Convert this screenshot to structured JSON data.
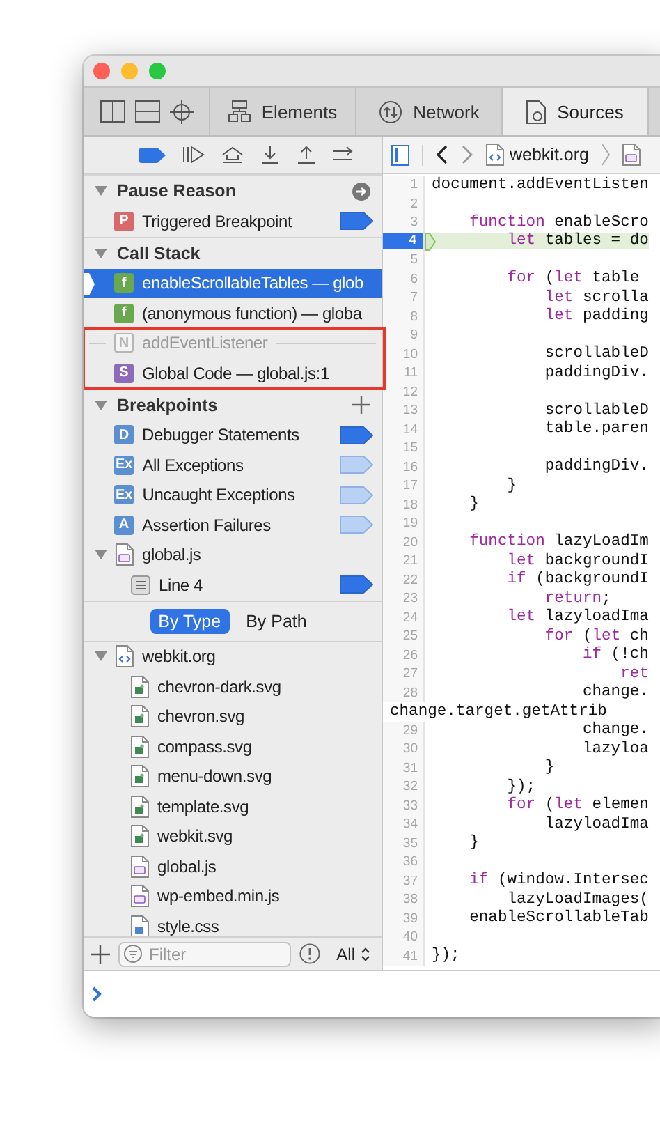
{
  "tabs": [
    {
      "label": "Elements",
      "kind": "elements",
      "selected": false
    },
    {
      "label": "Network",
      "kind": "network",
      "selected": false
    },
    {
      "label": "Sources",
      "kind": "sources",
      "selected": true
    }
  ],
  "debugger_toolbar": {
    "breakpoints_active": true
  },
  "navigation_bar": {
    "breadcrumbs": [
      {
        "kind": "html",
        "label": "webkit.org"
      },
      {
        "kind": "script"
      }
    ]
  },
  "sidebar": {
    "pause_reason": {
      "title": "Pause Reason",
      "expanded": true,
      "items": [
        {
          "badge": "P",
          "color": "#d9686a",
          "label": "Triggered Breakpoint",
          "enabled": true
        }
      ]
    },
    "call_stack": {
      "title": "Call Stack",
      "expanded": true,
      "items": [
        {
          "kind": "frame",
          "badge": "f",
          "color": "#6aa84f",
          "label": "enableScrollableTables — glob",
          "selected": true,
          "annotated": false
        },
        {
          "kind": "frame",
          "badge": "f",
          "color": "#6aa84f",
          "label": "(anonymous function) — globa",
          "selected": false,
          "annotated": false
        },
        {
          "kind": "async-boundary",
          "badge": "N",
          "color": "#b5b5b5",
          "label": "addEventListener",
          "selected": false,
          "annotated": true
        },
        {
          "kind": "frame",
          "badge": "S",
          "color": "#8e6bb8",
          "label": "Global Code — global.js:1",
          "selected": false,
          "annotated": true
        }
      ]
    },
    "breakpoints": {
      "title": "Breakpoints",
      "expanded": true,
      "items": [
        {
          "kind": "breakpoint",
          "badge": "D",
          "color": "#5b8fd0",
          "label": "Debugger Statements",
          "enabled": true
        },
        {
          "kind": "breakpoint",
          "badge": "Ex",
          "color": "#5b8fd0",
          "label": "All Exceptions",
          "enabled": false
        },
        {
          "kind": "breakpoint",
          "badge": "Ex",
          "color": "#5b8fd0",
          "label": "Uncaught Exceptions",
          "enabled": false
        },
        {
          "kind": "breakpoint",
          "badge": "A",
          "color": "#5b8fd0",
          "label": "Assertion Failures",
          "enabled": false
        },
        {
          "kind": "file",
          "label": "global.js",
          "expanded": true,
          "children": [
            {
              "kind": "line",
              "label": "Line 4",
              "enabled": true
            }
          ]
        }
      ]
    },
    "scope_bar": [
      {
        "label": "By Type",
        "selected": true
      },
      {
        "label": "By Path",
        "selected": false
      }
    ],
    "resources": {
      "label": "webkit.org",
      "expanded": true,
      "children": [
        {
          "kind": "image",
          "label": "chevron-dark.svg"
        },
        {
          "kind": "image",
          "label": "chevron.svg"
        },
        {
          "kind": "image",
          "label": "compass.svg"
        },
        {
          "kind": "image",
          "label": "menu-down.svg"
        },
        {
          "kind": "image",
          "label": "template.svg"
        },
        {
          "kind": "image",
          "label": "webkit.svg"
        },
        {
          "kind": "script",
          "label": "global.js"
        },
        {
          "kind": "script",
          "label": "wp-embed.min.js"
        },
        {
          "kind": "stylesheet",
          "label": "style.css"
        }
      ]
    },
    "filter": {
      "placeholder": "Filter",
      "scope": "All"
    }
  },
  "editor": {
    "lines": [
      {
        "kind": "line",
        "number": "1",
        "tokens": [
          {
            "kind": "plain",
            "text": "document.addEventListen"
          }
        ]
      },
      {
        "kind": "line",
        "number": "2"
      },
      {
        "kind": "line",
        "number": "3",
        "tokens": [
          {
            "kind": "keyword",
            "text": "    function"
          },
          {
            "kind": "plain",
            "text": " enableScro"
          }
        ]
      },
      {
        "kind": "current",
        "number": "4",
        "tokens": [
          {
            "kind": "keyword",
            "text": "        let"
          },
          {
            "kind": "plain",
            "text": " tables = do"
          }
        ]
      },
      {
        "kind": "line",
        "number": "5"
      },
      {
        "kind": "line",
        "number": "6",
        "tokens": [
          {
            "kind": "keyword",
            "text": "        for"
          },
          {
            "kind": "plain",
            "text": " ("
          },
          {
            "kind": "keyword",
            "text": "let"
          },
          {
            "kind": "plain",
            "text": " table"
          }
        ]
      },
      {
        "kind": "line",
        "number": "7",
        "tokens": [
          {
            "kind": "keyword",
            "text": "            let"
          },
          {
            "kind": "plain",
            "text": " scrolla"
          }
        ]
      },
      {
        "kind": "line",
        "number": "8",
        "tokens": [
          {
            "kind": "keyword",
            "text": "            let"
          },
          {
            "kind": "plain",
            "text": " padding"
          }
        ]
      },
      {
        "kind": "line",
        "number": "9"
      },
      {
        "kind": "line",
        "number": "10",
        "tokens": [
          {
            "kind": "plain",
            "text": "            scrollableD"
          }
        ]
      },
      {
        "kind": "line",
        "number": "11",
        "tokens": [
          {
            "kind": "plain",
            "text": "            paddingDiv."
          }
        ]
      },
      {
        "kind": "line",
        "number": "12"
      },
      {
        "kind": "line",
        "number": "13",
        "tokens": [
          {
            "kind": "plain",
            "text": "            scrollableD"
          }
        ]
      },
      {
        "kind": "line",
        "number": "14",
        "tokens": [
          {
            "kind": "plain",
            "text": "            table.paren"
          }
        ]
      },
      {
        "kind": "line",
        "number": "15"
      },
      {
        "kind": "line",
        "number": "16",
        "tokens": [
          {
            "kind": "plain",
            "text": "            paddingDiv."
          }
        ]
      },
      {
        "kind": "line",
        "number": "17",
        "tokens": [
          {
            "kind": "plain",
            "text": "        }"
          }
        ]
      },
      {
        "kind": "line",
        "number": "18",
        "tokens": [
          {
            "kind": "plain",
            "text": "    }"
          }
        ]
      },
      {
        "kind": "line",
        "number": "19"
      },
      {
        "kind": "line",
        "number": "20",
        "tokens": [
          {
            "kind": "keyword",
            "text": "    function"
          },
          {
            "kind": "plain",
            "text": " lazyLoadIm"
          }
        ]
      },
      {
        "kind": "line",
        "number": "21",
        "tokens": [
          {
            "kind": "keyword",
            "text": "        let"
          },
          {
            "kind": "plain",
            "text": " backgroundI"
          }
        ]
      },
      {
        "kind": "line",
        "number": "22",
        "tokens": [
          {
            "kind": "keyword",
            "text": "        if"
          },
          {
            "kind": "plain",
            "text": " (backgroundI"
          }
        ]
      },
      {
        "kind": "line",
        "number": "23",
        "tokens": [
          {
            "kind": "keyword",
            "text": "            return"
          },
          {
            "kind": "plain",
            "text": ";"
          }
        ]
      },
      {
        "kind": "line",
        "number": "24",
        "tokens": [
          {
            "kind": "keyword",
            "text": "        let"
          },
          {
            "kind": "plain",
            "text": " lazyloadIma"
          }
        ]
      },
      {
        "kind": "line",
        "number": "25",
        "tokens": [
          {
            "kind": "keyword",
            "text": "            for"
          },
          {
            "kind": "plain",
            "text": " ("
          },
          {
            "kind": "keyword",
            "text": "let"
          },
          {
            "kind": "plain",
            "text": " ch"
          }
        ]
      },
      {
        "kind": "line",
        "number": "26",
        "tokens": [
          {
            "kind": "keyword",
            "text": "                if"
          },
          {
            "kind": "plain",
            "text": " (!ch"
          }
        ]
      },
      {
        "kind": "line",
        "number": "27",
        "tokens": [
          {
            "kind": "keyword",
            "text": "                    ret"
          }
        ]
      },
      {
        "kind": "line",
        "number": "28",
        "tokens": [
          {
            "kind": "plain",
            "text": "                change."
          }
        ]
      },
      {
        "kind": "continuation",
        "tokens": [
          {
            "kind": "plain",
            "text": "change.target.getAttrib"
          }
        ]
      },
      {
        "kind": "line",
        "number": "29",
        "tokens": [
          {
            "kind": "plain",
            "text": "                change."
          }
        ]
      },
      {
        "kind": "line",
        "number": "30",
        "tokens": [
          {
            "kind": "plain",
            "text": "                lazyloa"
          }
        ]
      },
      {
        "kind": "line",
        "number": "31",
        "tokens": [
          {
            "kind": "plain",
            "text": "            }"
          }
        ]
      },
      {
        "kind": "line",
        "number": "32",
        "tokens": [
          {
            "kind": "plain",
            "text": "        });"
          }
        ]
      },
      {
        "kind": "line",
        "number": "33",
        "tokens": [
          {
            "kind": "keyword",
            "text": "        for"
          },
          {
            "kind": "plain",
            "text": " ("
          },
          {
            "kind": "keyword",
            "text": "let"
          },
          {
            "kind": "plain",
            "text": " elemen"
          }
        ]
      },
      {
        "kind": "line",
        "number": "34",
        "tokens": [
          {
            "kind": "plain",
            "text": "            lazyloadIma"
          }
        ]
      },
      {
        "kind": "line",
        "number": "35",
        "tokens": [
          {
            "kind": "plain",
            "text": "    }"
          }
        ]
      },
      {
        "kind": "line",
        "number": "36"
      },
      {
        "kind": "line",
        "number": "37",
        "tokens": [
          {
            "kind": "keyword",
            "text": "    if"
          },
          {
            "kind": "plain",
            "text": " (window.Intersec"
          }
        ]
      },
      {
        "kind": "line",
        "number": "38",
        "tokens": [
          {
            "kind": "plain",
            "text": "        lazyLoadImages("
          }
        ]
      },
      {
        "kind": "line",
        "number": "39",
        "tokens": [
          {
            "kind": "plain",
            "text": "    enableScrollableTab"
          }
        ]
      },
      {
        "kind": "line",
        "number": "40"
      },
      {
        "kind": "line",
        "number": "41",
        "tokens": [
          {
            "kind": "plain",
            "text": "});"
          }
        ]
      }
    ]
  }
}
